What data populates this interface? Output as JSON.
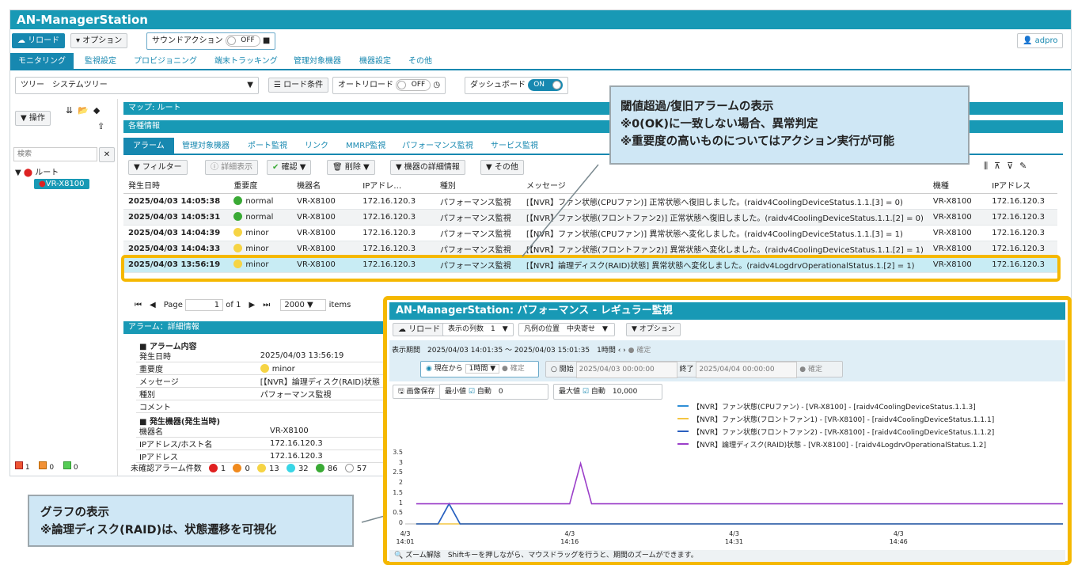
{
  "app": {
    "title": "AN-ManagerStation",
    "user": "adpro"
  },
  "toolbar": {
    "reload": "リロード",
    "option": "オプション",
    "sound_label": "サウンドアクション",
    "sound_state": "OFF"
  },
  "nav_tabs": [
    "モニタリング",
    "監視設定",
    "プロビジョニング",
    "端末トラッキング",
    "管理対象機器",
    "機器設定",
    "その他"
  ],
  "subbar": {
    "tree_label": "ツリー",
    "tree_value": "システムツリー",
    "load_condition": "ロード条件",
    "auto_reload": "オートリロード",
    "auto_state": "OFF",
    "dashboard": "ダッシュボード",
    "dash_state": "ON"
  },
  "left": {
    "operation": "操作",
    "search_placeholder": "検索",
    "root": "ルート",
    "device": "VR-X8100",
    "counts": [
      "1",
      "0",
      "0"
    ]
  },
  "panels": {
    "map": "マップ: ルート",
    "info": "各種情報"
  },
  "info_tabs": [
    "アラーム",
    "管理対象機器",
    "ポート監視",
    "リンク",
    "MMRP監視",
    "パフォーマンス監視",
    "サービス監視"
  ],
  "grid_toolbar": {
    "filter": "フィルター",
    "detail": "詳細表示",
    "confirm": "確認",
    "delete": "削除",
    "device_detail": "機器の詳細情報",
    "other": "その他"
  },
  "grid": {
    "headers": [
      "発生日時",
      "重要度",
      "機器名",
      "IPアドレ…",
      "種別",
      "メッセージ",
      "機種",
      "IPアドレス"
    ],
    "rows": [
      [
        "2025/04/03 14:05:38",
        "normal",
        "VR-X8100",
        "172.16.120.3",
        "パフォーマンス監視",
        "[【NVR】ファン状態(CPUファン)] 正常状態へ復旧しました。(raidv4CoolingDeviceStatus.1.1.[3] = 0)",
        "VR-X8100",
        "172.16.120.3"
      ],
      [
        "2025/04/03 14:05:31",
        "normal",
        "VR-X8100",
        "172.16.120.3",
        "パフォーマンス監視",
        "[【NVR】ファン状態(フロントファン2)] 正常状態へ復旧しました。(raidv4CoolingDeviceStatus.1.1.[2] = 0)",
        "VR-X8100",
        "172.16.120.3"
      ],
      [
        "2025/04/03 14:04:39",
        "minor",
        "VR-X8100",
        "172.16.120.3",
        "パフォーマンス監視",
        "[【NVR】ファン状態(CPUファン)] 異常状態へ変化しました。(raidv4CoolingDeviceStatus.1.1.[3] = 1)",
        "VR-X8100",
        "172.16.120.3"
      ],
      [
        "2025/04/03 14:04:33",
        "minor",
        "VR-X8100",
        "172.16.120.3",
        "パフォーマンス監視",
        "[【NVR】ファン状態(フロントファン2)] 異常状態へ変化しました。(raidv4CoolingDeviceStatus.1.1.[2] = 1)",
        "VR-X8100",
        "172.16.120.3"
      ],
      [
        "2025/04/03 13:56:19",
        "minor",
        "VR-X8100",
        "172.16.120.3",
        "パフォーマンス監視",
        "[【NVR】論理ディスク(RAID)状態] 異常状態へ変化しました。(raidv4LogdrvOperationalStatus.1.[2] = 1)",
        "VR-X8100",
        "172.16.120.3"
      ]
    ]
  },
  "pager": {
    "page_label": "Page",
    "page": "1",
    "of": "of 1",
    "size": "2000",
    "items": "items"
  },
  "alarm_detail": {
    "title": "アラーム：詳細情報",
    "sec1": "アラーム内容",
    "rows1": [
      [
        "発生日時",
        "2025/04/03 13:56:19"
      ],
      [
        "重要度",
        "minor"
      ],
      [
        "メッセージ",
        "[【NVR】論理ディスク(RAID)状態"
      ],
      [
        "種別",
        "パフォーマンス監視"
      ],
      [
        "コメント",
        ""
      ]
    ],
    "sec2": "発生機器(発生当時)",
    "rows2": [
      [
        "機器名",
        "VR-X8100"
      ],
      [
        "IPアドレス/ホスト名",
        "172.16.120.3"
      ],
      [
        "IPアドレス",
        "172.16.120.3"
      ]
    ]
  },
  "status": {
    "label": "未確認アラーム件数",
    "counts": [
      "1",
      "0",
      "13",
      "32",
      "86",
      "57"
    ]
  },
  "callout1": [
    "閾値超過/復旧アラームの表示",
    "※0(OK)に一致しない場合、異常判定",
    "※重要度の高いものについてはアクション実行が可能"
  ],
  "callout2": [
    "グラフの表示",
    "※論理ディスク(RAID)は、状態遷移を可視化"
  ],
  "perf": {
    "title": "AN-ManagerStation: パフォーマンス - レギュラー監視",
    "reload": "リロード",
    "cols_label": "表示の列数",
    "cols": "1",
    "legend_pos_label": "凡例の位置",
    "legend_pos": "中央寄せ",
    "option": "オプション",
    "period_label": "表示期間",
    "period": "2025/04/03 14:01:35 ～ 2025/04/03 15:01:35",
    "span": "1時間",
    "confirm": "確定",
    "from_now": "現在から",
    "from_span": "1時間",
    "start": "開始",
    "start_val": "2025/04/03 00:00:00",
    "end": "終了",
    "end_val": "2025/04/04 00:00:00",
    "save": "画像保存",
    "min_label": "最小値",
    "auto": "自動",
    "min_val": "0",
    "max_label": "最大値",
    "max_val": "10,000",
    "zoom_reset": "ズーム解除",
    "zoom_hint": "Shiftキーを押しながら、マウスドラッグを行うと、期間のズームができます。"
  },
  "chart_data": {
    "type": "line",
    "x": [
      "14:01",
      "14:04",
      "14:05",
      "14:06",
      "14:16",
      "14:17",
      "14:18",
      "15:01"
    ],
    "yticks": [
      "3.5",
      "3",
      "2.5",
      "2",
      "1.5",
      "1",
      "0.5",
      "0"
    ],
    "ylim": [
      0,
      3.5
    ],
    "xticks": [
      "4/3\n14:01",
      "4/3\n14:16",
      "4/3\n14:31",
      "4/3\n14:46"
    ],
    "series": [
      {
        "name": "【NVR】ファン状態(CPUファン) - [VR-X8100] - [raidv4CoolingDeviceStatus.1.1.3]",
        "color": "#2f8fd6",
        "points": [
          [
            14.02,
            0
          ],
          [
            14.04,
            0
          ],
          [
            14.05,
            1
          ],
          [
            14.06,
            0
          ],
          [
            15.01,
            0
          ]
        ]
      },
      {
        "name": "【NVR】ファン状態(フロントファン1) - [VR-X8100] - [raidv4CoolingDeviceStatus.1.1.1]",
        "color": "#f4c542",
        "points": [
          [
            14.02,
            0
          ],
          [
            15.01,
            0
          ]
        ]
      },
      {
        "name": "【NVR】ファン状態(フロントファン2) - [VR-X8100] - [raidv4CoolingDeviceStatus.1.1.2]",
        "color": "#2a5fbf",
        "points": [
          [
            14.02,
            0
          ],
          [
            14.04,
            0
          ],
          [
            14.05,
            1
          ],
          [
            14.06,
            0
          ],
          [
            15.01,
            0
          ]
        ]
      },
      {
        "name": "【NVR】論理ディスク(RAID)状態 - [VR-X8100] - [raidv4LogdrvOperationalStatus.1.2]",
        "color": "#9b3fc9",
        "points": [
          [
            14.02,
            1
          ],
          [
            14.16,
            1
          ],
          [
            14.17,
            3
          ],
          [
            14.18,
            1
          ],
          [
            15.01,
            1
          ]
        ]
      }
    ]
  }
}
